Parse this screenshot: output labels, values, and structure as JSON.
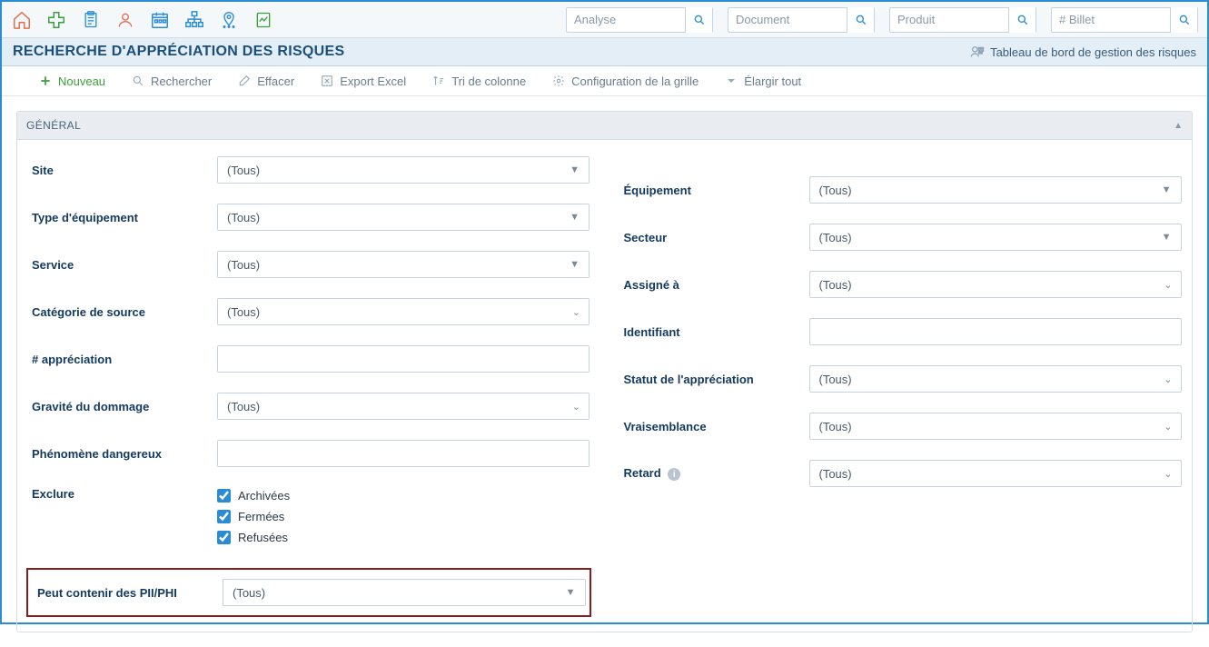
{
  "top_search": {
    "analyse": "Analyse",
    "document": "Document",
    "produit": "Produit",
    "billet": "# Billet"
  },
  "title": "RECHERCHE D'APPRÉCIATION DES RISQUES",
  "dashboard_link": "Tableau de bord de gestion des risques",
  "toolbar": {
    "nouveau": "Nouveau",
    "rechercher": "Rechercher",
    "effacer": "Effacer",
    "export": "Export Excel",
    "tri": "Tri de colonne",
    "config": "Configuration de la grille",
    "elargir": "Élargir tout"
  },
  "panel": {
    "general": "GÉNÉRAL"
  },
  "labels": {
    "site": "Site",
    "type_equip": "Type d'équipement",
    "service": "Service",
    "cat_source": "Catégorie de source",
    "num_apprec": "# appréciation",
    "gravite": "Gravité du dommage",
    "phenomene": "Phénomène dangereux",
    "exclure": "Exclure",
    "pii": "Peut contenir des PII/PHI",
    "equipement": "Équipement",
    "secteur": "Secteur",
    "assigne": "Assigné à",
    "identifiant": "Identifiant",
    "statut": "Statut de l'appréciation",
    "vraisemblance": "Vraisemblance",
    "retard": "Retard"
  },
  "values": {
    "tous": "(Tous)"
  },
  "exclure": {
    "archivees": "Archivées",
    "fermees": "Fermées",
    "refusees": "Refusées"
  }
}
